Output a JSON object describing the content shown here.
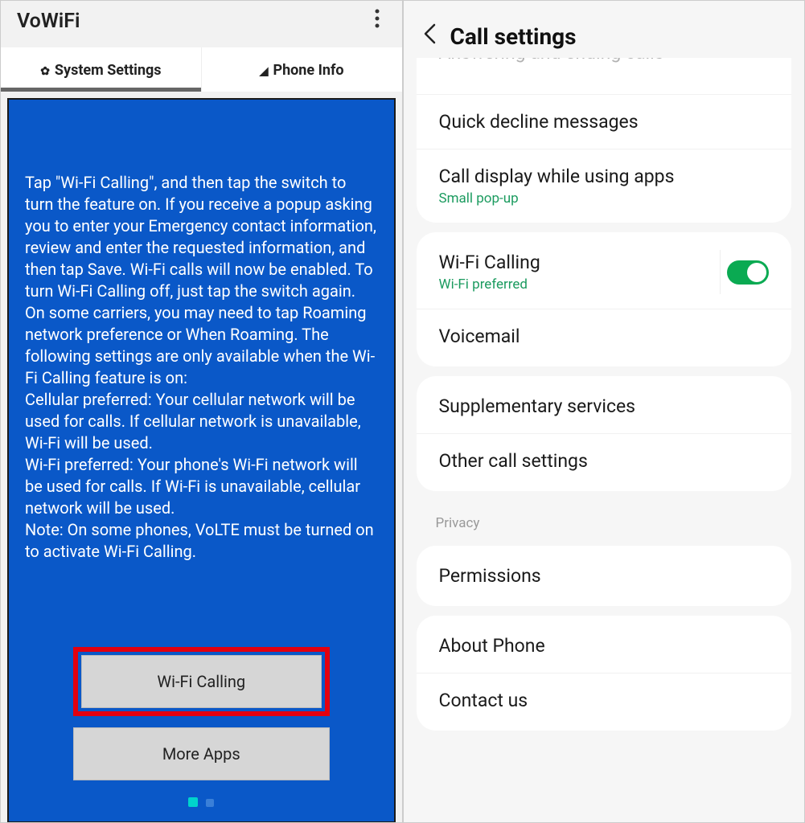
{
  "left": {
    "title": "VoWiFi",
    "tabs": {
      "system": "System Settings",
      "phone": "Phone Info"
    },
    "body": "Tap \"Wi-Fi Calling\", and then tap the switch to turn the feature on. If you receive a popup asking you to enter your Emergency contact information, review and enter the requested information, and then tap Save. Wi-Fi calls will now be enabled. To turn Wi-Fi Calling off, just tap the switch again.\nOn some carriers, you may need to tap Roaming network preference or When Roaming. The following settings are only available when the Wi-Fi Calling feature is on:\nCellular preferred: Your cellular network will be used for calls. If cellular network is unavailable, Wi-Fi will be used.\nWi-Fi preferred: Your phone's Wi-Fi network will be used for calls. If Wi-Fi is unavailable, cellular network will be used.\nNote: On some phones, VoLTE must be turned on to activate Wi-Fi Calling.",
    "buttons": {
      "wifi": "Wi-Fi Calling",
      "more": "More Apps"
    }
  },
  "right": {
    "title": "Call settings",
    "cutoff_row": "Answering and ending calls",
    "rows": {
      "quick_decline": "Quick decline messages",
      "call_display": "Call display while using apps",
      "call_display_sub": "Small pop-up",
      "wifi_calling": "Wi-Fi Calling",
      "wifi_calling_sub": "Wi-Fi preferred",
      "voicemail": "Voicemail",
      "supplementary": "Supplementary services",
      "other": "Other call settings",
      "privacy_header": "Privacy",
      "permissions": "Permissions",
      "about": "About Phone",
      "contact": "Contact us"
    }
  }
}
